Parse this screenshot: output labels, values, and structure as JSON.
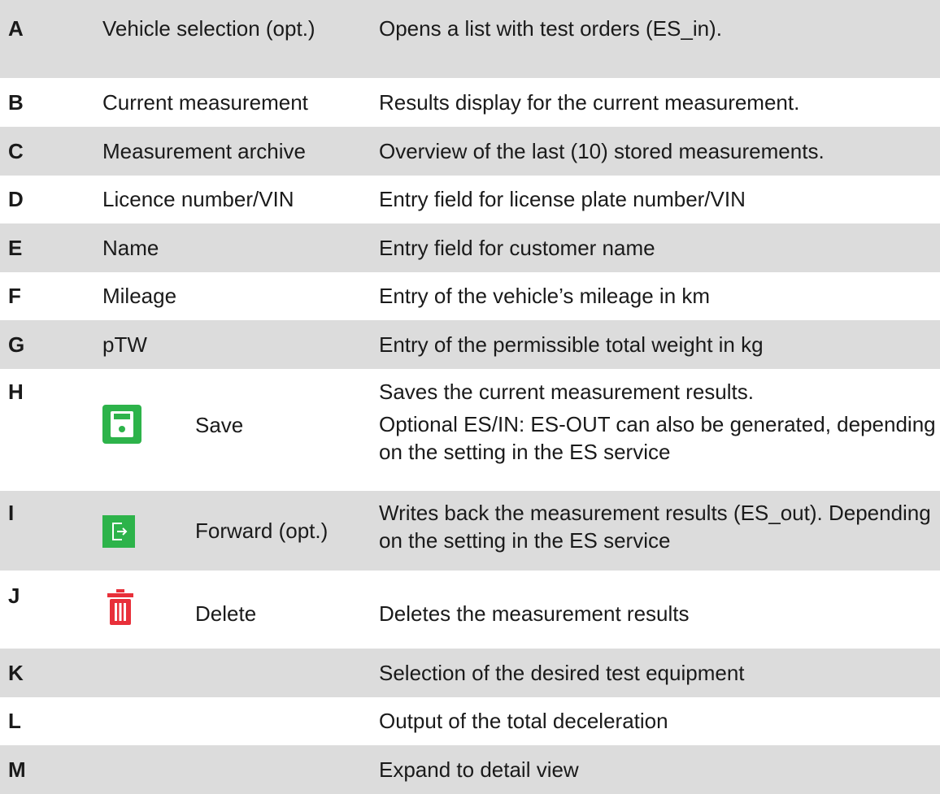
{
  "rows": [
    {
      "key": "A",
      "label": "Vehicle selection (opt.)",
      "description": [
        "Opens a list with test orders (ES_in)."
      ]
    },
    {
      "key": "B",
      "label": "Current measurement",
      "description": [
        "Results display for the current measurement."
      ]
    },
    {
      "key": "C",
      "label": "Measurement archive",
      "description": [
        "Overview of the last (10) stored measurements."
      ]
    },
    {
      "key": "D",
      "label": "Licence number/VIN",
      "description": [
        "Entry field for license plate number/VIN"
      ]
    },
    {
      "key": "E",
      "label": "Name",
      "description": [
        "Entry field for customer name"
      ]
    },
    {
      "key": "F",
      "label": "Mileage",
      "description": [
        "Entry of the vehicle’s mileage in km"
      ]
    },
    {
      "key": "G",
      "label": "pTW",
      "description": [
        "Entry of the permissible total weight in kg"
      ]
    },
    {
      "key": "H",
      "icon": "save-icon",
      "label": "Save",
      "description": [
        "Saves the current measurement results.",
        "Optional ES/IN: ES-OUT can also be generated, depending on the setting in the ES service"
      ]
    },
    {
      "key": "I",
      "icon": "forward-icon",
      "label": "Forward (opt.)",
      "description": [
        "Writes back the measurement results (ES_out). Depending on the setting in the ES service"
      ]
    },
    {
      "key": "J",
      "icon": "delete-icon",
      "label": "Delete",
      "description": [
        "Deletes the measurement results"
      ]
    },
    {
      "key": "K",
      "label": "",
      "description": [
        "Selection of the desired test equipment"
      ]
    },
    {
      "key": "L",
      "label": "",
      "description": [
        "Output of the total deceleration"
      ]
    },
    {
      "key": "M",
      "label": "",
      "description": [
        "Expand to detail view"
      ]
    }
  ],
  "colors": {
    "row_shade": "#dcdcdc",
    "save_green": "#2db34a",
    "forward_green": "#2db34a",
    "delete_red": "#e8303a"
  }
}
